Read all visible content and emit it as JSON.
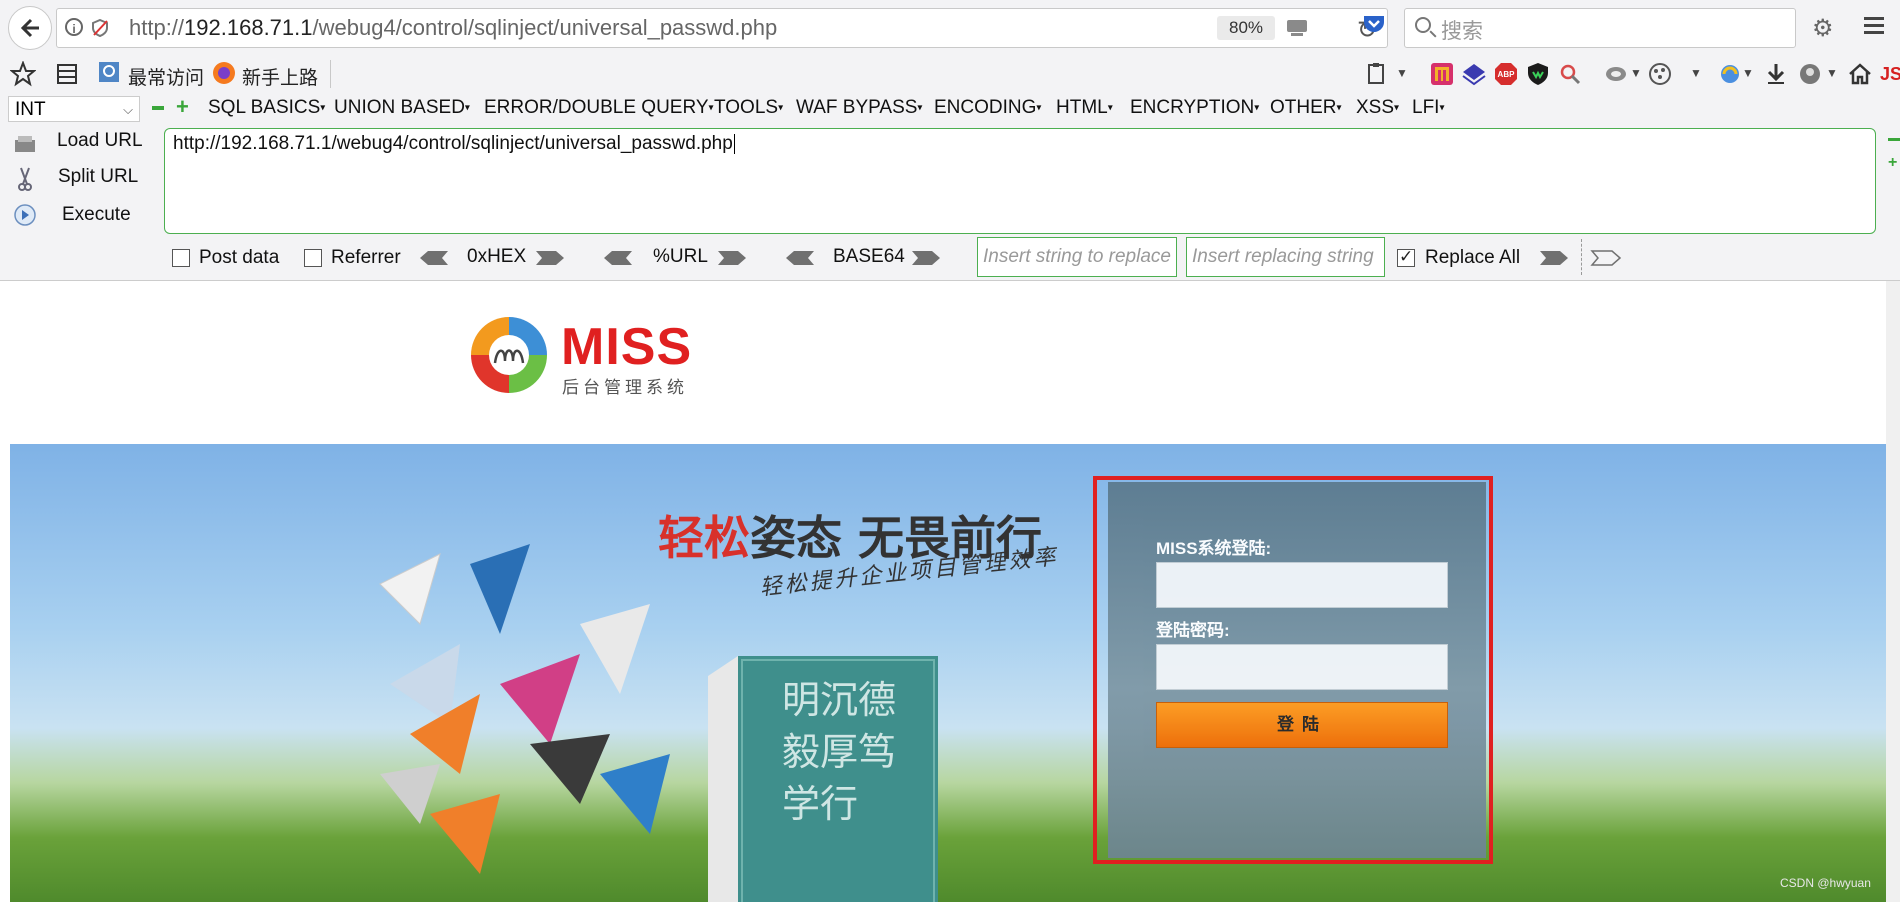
{
  "browser": {
    "url_prefix": "http://",
    "url_host": "192.168.71.1",
    "url_path": "/webug4/control/sqlinject/universal_passwd.php",
    "zoom": "80%",
    "search_placeholder": "搜索"
  },
  "bookmarks": {
    "most_visited": "最常访问",
    "getting_started": "新手上路"
  },
  "hackbar": {
    "select_value": "INT",
    "menus": [
      "SQL BASICS",
      "UNION BASED",
      "ERROR/DOUBLE QUERY",
      "TOOLS",
      "WAF BYPASS",
      "ENCODING",
      "HTML",
      "ENCRYPTION",
      "OTHER",
      "XSS",
      "LFI"
    ],
    "load_url": "Load URL",
    "split_url": "Split URL",
    "execute": "Execute",
    "url_value": "http://192.168.71.1/webug4/control/sqlinject/universal_passwd.php",
    "post_data": "Post data",
    "referrer": "Referrer",
    "hex": "0xHEX",
    "url_enc": "%URL",
    "base64": "BASE64",
    "replace_placeholder": "Insert string to replace",
    "replacing_placeholder": "Insert replacing string",
    "replace_all": "Replace All"
  },
  "page": {
    "logo_text": "MISS",
    "logo_sub": "后台管理系统",
    "slogan_red": "轻松",
    "slogan_rest": "姿态 无畏前行",
    "slogan_sub": "轻松提升企业项目管理效率",
    "book_chars": "明沉德毅厚笃学行",
    "login_user_label": "MISS系统登陆:",
    "login_pass_label": "登陆密码:",
    "login_button": "登陆"
  },
  "watermark": "CSDN @hwyuan",
  "colors": {
    "accent_red": "#e02020",
    "button_orange": "#f58200",
    "hackbar_green": "#4caf50"
  }
}
